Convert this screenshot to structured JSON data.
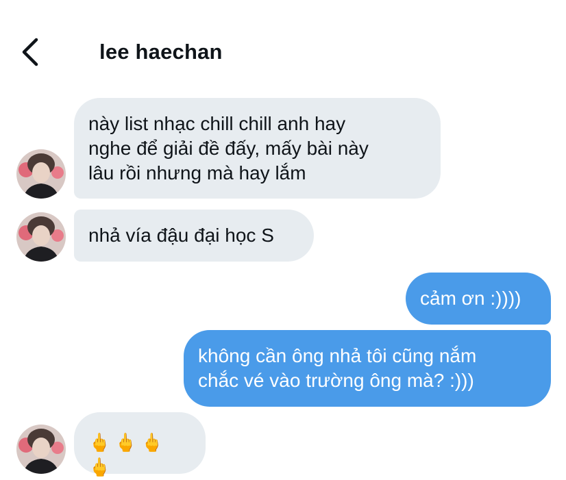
{
  "header": {
    "title": "lee haechan"
  },
  "messages": [
    {
      "sender": "lee haechan",
      "direction": "incoming",
      "text": "này list nhạc chill chill anh hay\nnghe để giải đề đấy, mấy bài này\nlâu rồi nhưng mà hay lắm"
    },
    {
      "sender": "lee haechan",
      "direction": "incoming",
      "text": "nhả vía đậu đại học S"
    },
    {
      "sender": "me",
      "direction": "outgoing",
      "text": "cảm ơn :))))"
    },
    {
      "sender": "me",
      "direction": "outgoing",
      "text": "không cần ông nhả tôi cũng nắm\nchắc vé vào trường ông mà? :)))"
    },
    {
      "sender": "lee haechan",
      "direction": "incoming",
      "text": "🖕🖕🖕🖕"
    }
  ],
  "colors": {
    "incoming_bubble": "#e7ecf0",
    "outgoing_bubble": "#4a9be9",
    "text_dark": "#0f1419"
  },
  "icons": {
    "back": "chevron-left-icon"
  }
}
